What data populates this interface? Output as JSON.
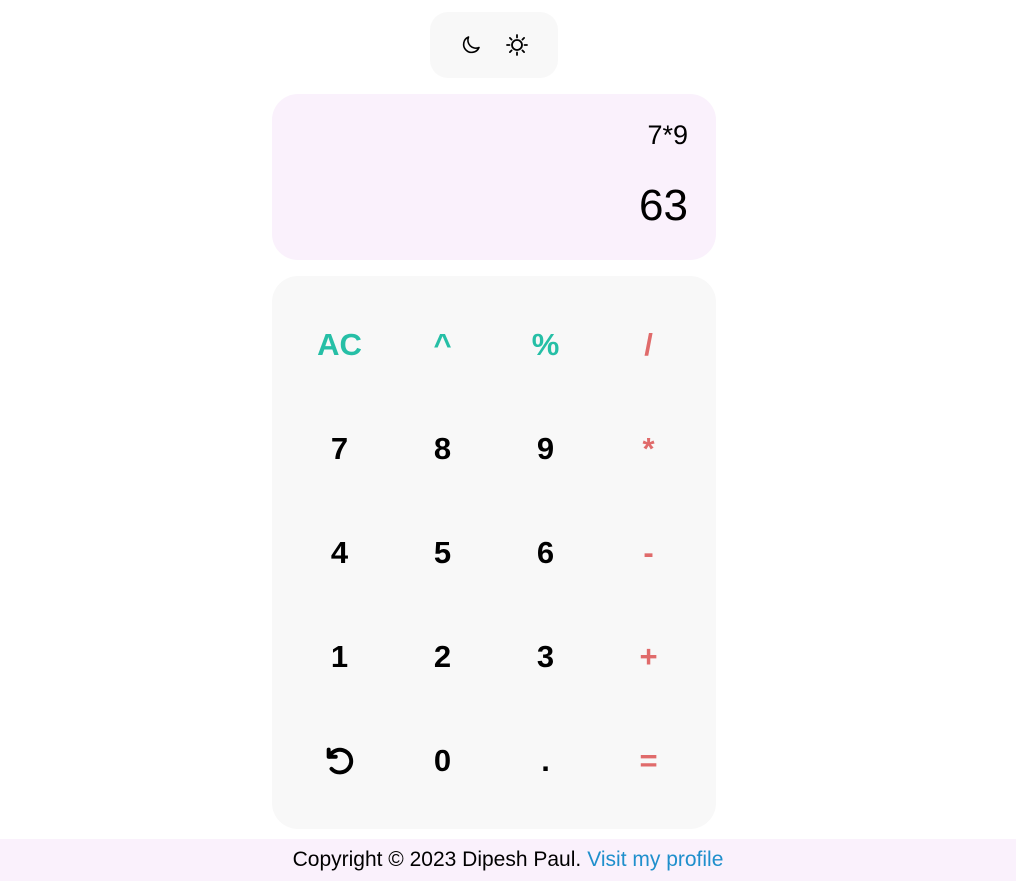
{
  "theme_toggle": {
    "dark_icon": "moon-icon",
    "light_icon": "sun-icon"
  },
  "display": {
    "expression": "7*9",
    "result": "63"
  },
  "keypad": {
    "rows": [
      [
        {
          "label": "AC",
          "kind": "func"
        },
        {
          "label": "^",
          "kind": "func"
        },
        {
          "label": "%",
          "kind": "func"
        },
        {
          "label": "/",
          "kind": "op"
        }
      ],
      [
        {
          "label": "7",
          "kind": "num"
        },
        {
          "label": "8",
          "kind": "num"
        },
        {
          "label": "9",
          "kind": "num"
        },
        {
          "label": "*",
          "kind": "op"
        }
      ],
      [
        {
          "label": "4",
          "kind": "num"
        },
        {
          "label": "5",
          "kind": "num"
        },
        {
          "label": "6",
          "kind": "num"
        },
        {
          "label": "-",
          "kind": "op"
        }
      ],
      [
        {
          "label": "1",
          "kind": "num"
        },
        {
          "label": "2",
          "kind": "num"
        },
        {
          "label": "3",
          "kind": "num"
        },
        {
          "label": "+",
          "kind": "op"
        }
      ],
      [
        {
          "label": "",
          "kind": "num",
          "icon": "undo-icon"
        },
        {
          "label": "0",
          "kind": "num"
        },
        {
          "label": ".",
          "kind": "num"
        },
        {
          "label": "=",
          "kind": "op"
        }
      ]
    ],
    "colors": {
      "func": "#26bfa6",
      "op": "#e06b6b",
      "num": "#000000"
    }
  },
  "footer": {
    "copyright": "Copyright © 2023 Dipesh Paul.",
    "link_text": "Visit my profile",
    "link_color": "#1f8fcc"
  }
}
